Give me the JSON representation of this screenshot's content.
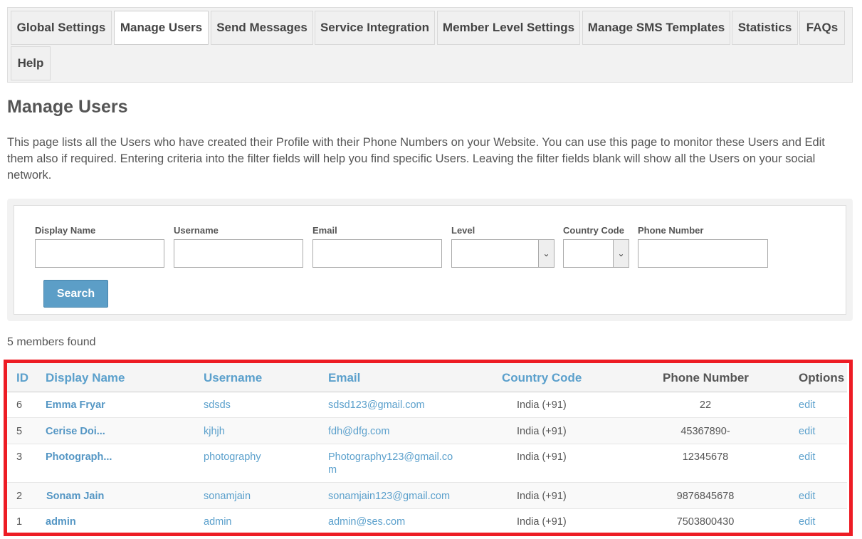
{
  "tabs": [
    {
      "label": "Global Settings",
      "active": false
    },
    {
      "label": "Manage Users",
      "active": true
    },
    {
      "label": "Send Messages",
      "active": false
    },
    {
      "label": "Service Integration",
      "active": false
    },
    {
      "label": "Member Level Settings",
      "active": false
    },
    {
      "label": "Manage SMS Templates",
      "active": false
    },
    {
      "label": "Statistics",
      "active": false
    },
    {
      "label": "FAQs",
      "active": false
    },
    {
      "label": "Help",
      "active": false
    }
  ],
  "page_title": "Manage Users",
  "intro_text": "This page lists all the Users who have created their Profile with their Phone Numbers on your Website. You can use this page to monitor these Users and Edit them also if required. Entering criteria into the filter fields will help you find specific Users. Leaving the filter fields blank will show all the Users on your social network.",
  "filter": {
    "display_name_label": "Display Name",
    "display_name_value": "",
    "username_label": "Username",
    "username_value": "",
    "email_label": "Email",
    "email_value": "",
    "level_label": "Level",
    "level_value": "",
    "country_code_label": "Country Code",
    "country_code_value": "",
    "phone_number_label": "Phone Number",
    "phone_number_value": "",
    "search_label": "Search"
  },
  "members_found": "5 members found",
  "table": {
    "headers": {
      "id": "ID",
      "display_name": "Display Name",
      "username": "Username",
      "email": "Email",
      "country_code": "Country Code",
      "phone_number": "Phone Number",
      "options": "Options"
    },
    "rows": [
      {
        "id": "6",
        "display_name": "Emma Fryar",
        "username": "sdsds",
        "email": "sdsd123@gmail.com",
        "country_code": "India (+91)",
        "phone_number": "22",
        "option": "edit"
      },
      {
        "id": "5",
        "display_name": "Cerise Doi...",
        "username": "kjhjh",
        "email": "fdh@dfg.com",
        "country_code": "India (+91)",
        "phone_number": "45367890-",
        "option": "edit"
      },
      {
        "id": "3",
        "display_name": "Photograph...",
        "username": "photography",
        "email": "Photography123@gmail.com",
        "country_code": "India (+91)",
        "phone_number": "12345678",
        "option": "edit"
      },
      {
        "id": "2",
        "display_name": "Sonam Jain",
        "username": "sonamjain",
        "email": "sonamjain123@gmail.com",
        "country_code": "India (+91)",
        "phone_number": "9876845678",
        "option": "edit"
      },
      {
        "id": "1",
        "display_name": "admin",
        "username": "admin",
        "email": "admin@ses.com",
        "country_code": "India (+91)",
        "phone_number": "7503800430",
        "option": "edit"
      }
    ]
  },
  "colors": {
    "link": "#5ba0cc",
    "button": "#5c9ec7",
    "highlight_frame": "#ed1c24"
  }
}
